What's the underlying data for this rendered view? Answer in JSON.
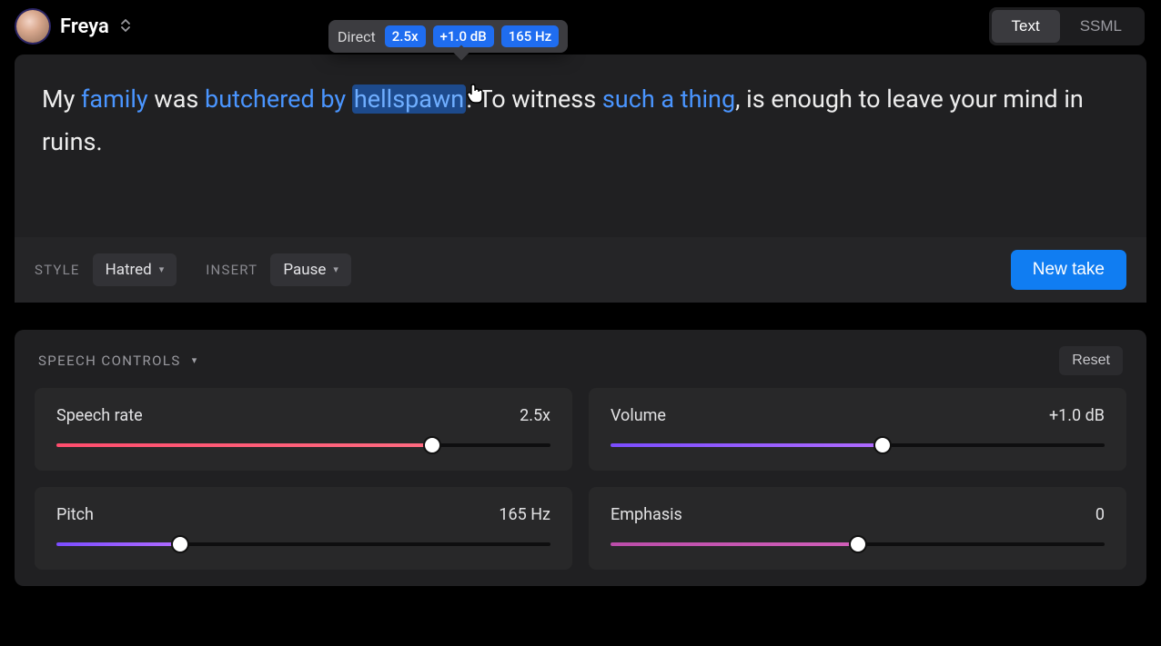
{
  "voice": {
    "name": "Freya"
  },
  "modes": {
    "text": "Text",
    "ssml": "SSML",
    "active": "text"
  },
  "tooltip": {
    "label": "Direct",
    "rate": "2.5x",
    "volume": "+1.0 dB",
    "pitch": "165 Hz"
  },
  "script": {
    "w1": "My ",
    "w2": "family",
    "w3": " was ",
    "w4": "butchered by ",
    "w5": "hellspawn",
    "w6": ". To witness ",
    "w7": "such a thing",
    "w8": ", is enough to leave your mind in ruins."
  },
  "footer": {
    "styleLabel": "STYLE",
    "styleValue": "Hatred",
    "insertLabel": "INSERT",
    "insertValue": "Pause",
    "newTake": "New take"
  },
  "controls": {
    "title": "SPEECH CONTROLS",
    "reset": "Reset",
    "rate": {
      "label": "Speech rate",
      "value": "2.5x",
      "pct": 76
    },
    "volume": {
      "label": "Volume",
      "value": "+1.0 dB",
      "pct": 55
    },
    "pitch": {
      "label": "Pitch",
      "value": "165 Hz",
      "pct": 25
    },
    "emphasis": {
      "label": "Emphasis",
      "value": "0",
      "pct": 50
    }
  }
}
